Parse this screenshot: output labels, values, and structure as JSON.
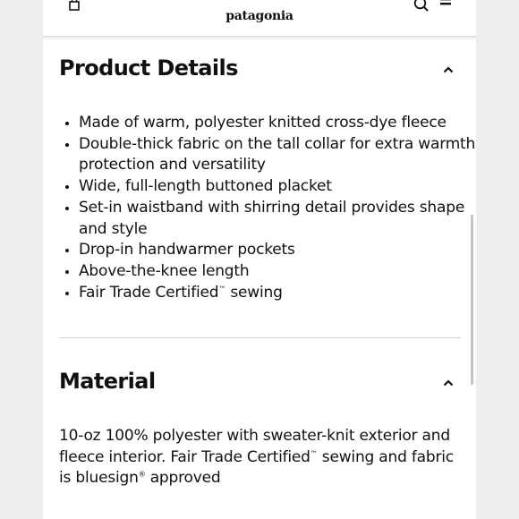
{
  "header": {
    "logo_text": "patagonia",
    "icons": {
      "bag": "bag-icon",
      "search": "search-icon",
      "menu": "menu-icon"
    }
  },
  "product_details": {
    "title": "Product Details",
    "expanded_icon": "caret-up-icon",
    "bullets": [
      "Made of warm, polyester knitted cross-dye fleece",
      "Double-thick fabric on the tall collar for extra warmth, protection and versatility",
      "Wide, full-length buttoned placket",
      "Set-in waistband with shirring detail provides shape and style",
      "Drop-in handwarmer pockets",
      "Above-the-knee length"
    ],
    "fair_trade_bullet": {
      "before": "Fair Trade Certified",
      "mark": "™",
      "after": " sewing"
    }
  },
  "material": {
    "title": "Material",
    "expanded_icon": "caret-up-icon",
    "part1": "10-oz 100% polyester with sweater-knit exterior and fleece interior. Fair Trade Certified",
    "tm": "™",
    "part2": " sewing and fabric is bluesign",
    "reg": "®",
    "part3": " approved"
  }
}
